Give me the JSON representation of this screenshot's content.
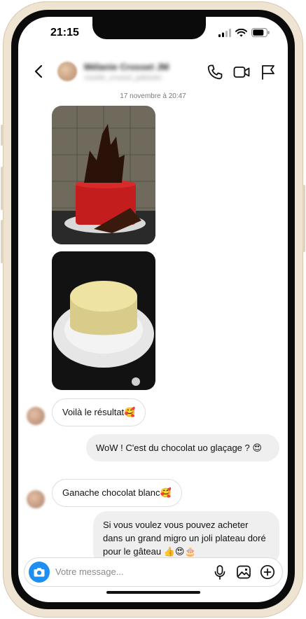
{
  "status_bar": {
    "time": "21:15"
  },
  "header": {
    "contact_name": "Mélanie Crosset JM",
    "contact_subtitle": "rosette_crosset_patissier"
  },
  "thread": {
    "date_label": "17 novembre à 20:47",
    "messages": [
      {
        "from": "contact",
        "text": "Voilà le résultat🥰"
      },
      {
        "from": "me",
        "text": "WoW ! C'est du chocolat uo glaçage ? 😍"
      },
      {
        "from": "contact",
        "text": "Ganache chocolat blanc🥰"
      },
      {
        "from": "me",
        "text": "Si vous voulez vous pouvez acheter dans un grand migro un joli plateau doré pour le gâteau 👍😍🎂"
      }
    ]
  },
  "composer": {
    "placeholder": "Votre message..."
  },
  "icons": {
    "back": "chevron-left-icon",
    "call": "phone-icon",
    "video": "video-camera-icon",
    "report": "flag-icon",
    "camera": "camera-icon",
    "mic": "microphone-icon",
    "gallery": "image-icon",
    "add": "plus-circle-icon"
  },
  "colors": {
    "accent": "#1e8ef1",
    "outgoing_bubble": "#efefef",
    "frame": "#efe3d2"
  }
}
